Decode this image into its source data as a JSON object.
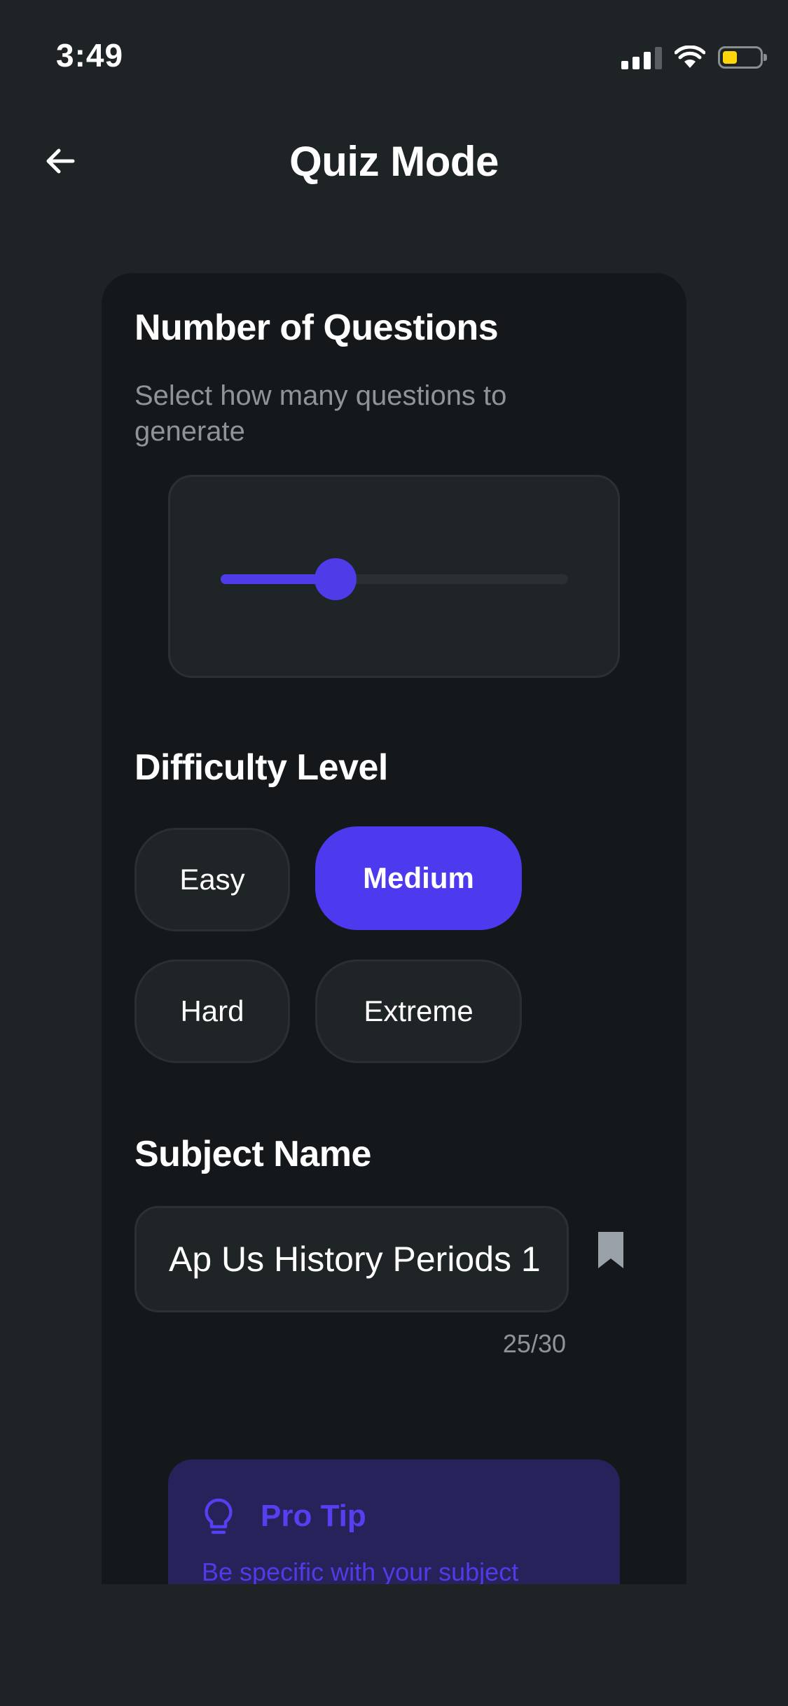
{
  "status_bar": {
    "time": "3:49",
    "icons": [
      "signal-icon",
      "wifi-icon",
      "battery-icon"
    ],
    "battery_color": "#ffd60a"
  },
  "header": {
    "back_icon": "arrow-left-icon",
    "title": "Quiz Mode"
  },
  "questions_section": {
    "title": "Number of  Questions",
    "subtitle": "Select how many questions to generate",
    "slider_level": 0.33
  },
  "difficulty_section": {
    "title": "Difficulty Level",
    "options": [
      "Easy",
      "Medium",
      "Hard",
      "Extreme"
    ],
    "selected": "Medium"
  },
  "subject_section": {
    "title": "Subject Name",
    "value": "Ap Us History Periods 1",
    "counter": "25/30",
    "bookmark_icon": "bookmark-icon"
  },
  "pro_tip": {
    "icon": "lightbulb-icon",
    "title": "Pro Tip",
    "text": "Be specific with your subject"
  },
  "colors": {
    "background": "#1e2326",
    "card": "#15181b",
    "accent": "#4d3aef",
    "tip_background": "#27235a"
  }
}
